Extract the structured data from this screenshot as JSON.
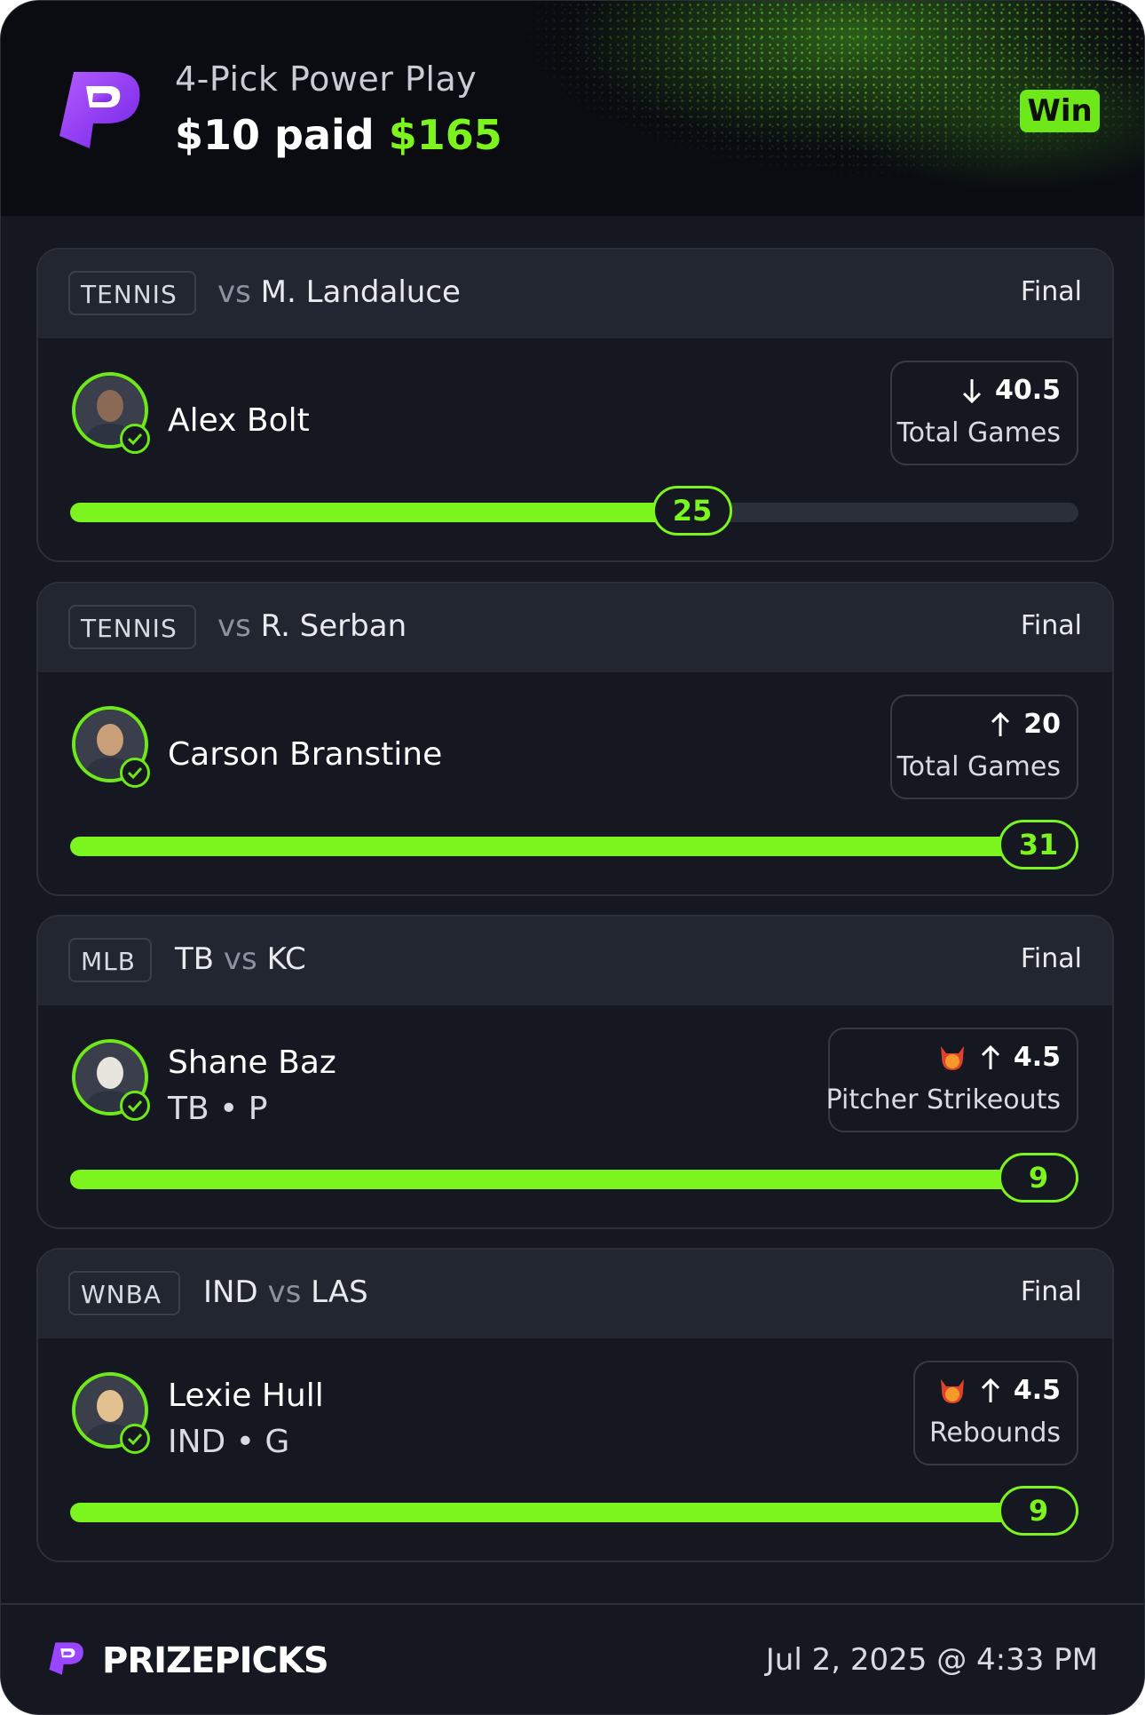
{
  "header": {
    "subtitle": "4-Pick Power Play",
    "paid_text": "$10 paid",
    "payout": "$165",
    "result_badge": "Win"
  },
  "picks": [
    {
      "league": "TENNIS",
      "team": "",
      "vs": "vs",
      "opponent": "M. Landaluce",
      "status": "Final",
      "player": "Alex Bolt",
      "info": "",
      "direction": "down",
      "line": "40.5",
      "stat": "Total Games",
      "result": "25",
      "progress": 0.617,
      "special_icon": false
    },
    {
      "league": "TENNIS",
      "team": "",
      "vs": "vs",
      "opponent": "R. Serban",
      "status": "Final",
      "player": "Carson Branstine",
      "info": "",
      "direction": "up",
      "line": "20",
      "stat": "Total Games",
      "result": "31",
      "progress": 1.0,
      "special_icon": false
    },
    {
      "league": "MLB",
      "team": "TB",
      "vs": "vs",
      "opponent": "KC",
      "status": "Final",
      "player": "Shane Baz",
      "info": "TB • P",
      "direction": "up",
      "line": "4.5",
      "stat": "Pitcher Strikeouts",
      "result": "9",
      "progress": 1.0,
      "special_icon": true
    },
    {
      "league": "WNBA",
      "team": "IND",
      "vs": "vs",
      "opponent": "LAS",
      "status": "Final",
      "player": "Lexie Hull",
      "info": "IND • G",
      "direction": "up",
      "line": "4.5",
      "stat": "Rebounds",
      "result": "9",
      "progress": 1.0,
      "special_icon": true
    }
  ],
  "footer": {
    "brand": "PRIZEPICKS",
    "timestamp": "Jul 2, 2025 @ 4:33 PM"
  },
  "colors": {
    "accent": "#7cf41e",
    "brand_purple": "#8b3cf5",
    "background": "#151821"
  }
}
